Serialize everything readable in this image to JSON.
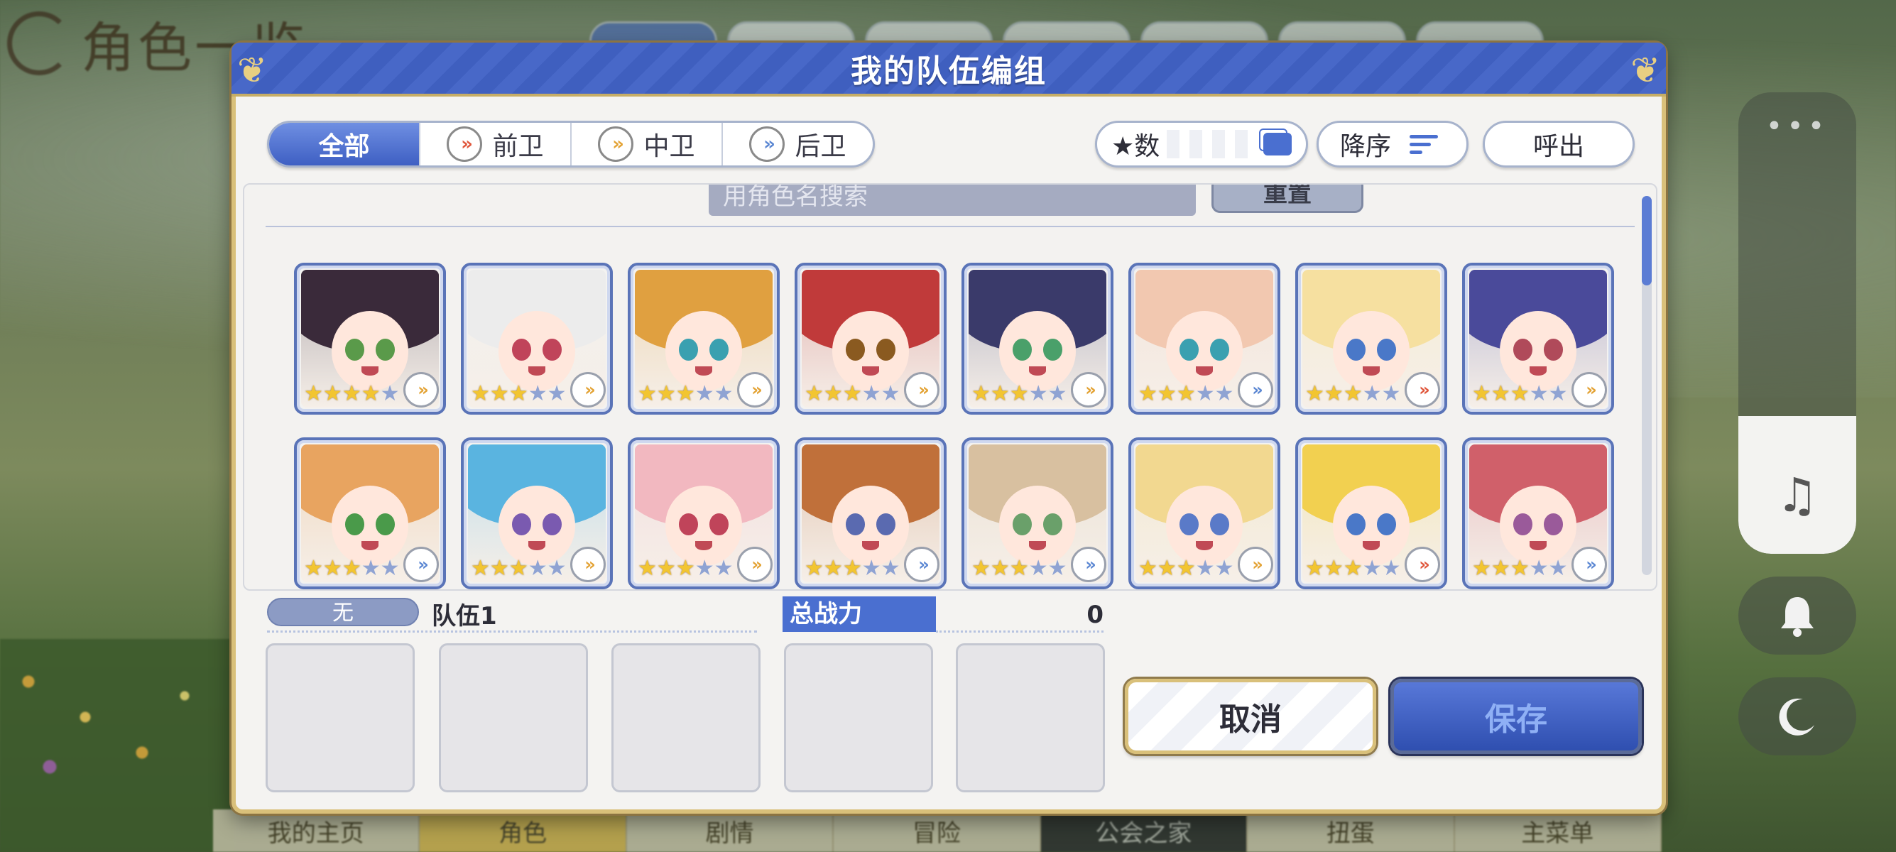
{
  "background": {
    "screen_title": "角色一览",
    "bottom_nav": [
      "我的主页",
      "角色",
      "剧情",
      "冒险",
      "公会之家",
      "扭蛋",
      "主菜单"
    ]
  },
  "dialog": {
    "title": "我的队伍编组",
    "filter_tabs": [
      {
        "label": "全部",
        "active": true,
        "icon": ""
      },
      {
        "label": "前卫",
        "active": false,
        "icon": "front-role-icon"
      },
      {
        "label": "中卫",
        "active": false,
        "icon": "mid-role-icon"
      },
      {
        "label": "后卫",
        "active": false,
        "icon": "back-role-icon"
      }
    ],
    "star_filter_label": "★数",
    "order_label": "降序",
    "call_label": "呼出",
    "search_placeholder": "用角色名搜索",
    "reset_label": "重置",
    "characters": [
      {
        "stars": 4,
        "role": "mid",
        "hair": "#3a2a3a",
        "eyes": "#5a9a4a"
      },
      {
        "stars": 3,
        "role": "mid",
        "hair": "#ececec",
        "eyes": "#c0445a"
      },
      {
        "stars": 3,
        "role": "mid",
        "hair": "#e0a040",
        "eyes": "#3aa0b0"
      },
      {
        "stars": 3,
        "role": "mid",
        "hair": "#c03a3a",
        "eyes": "#8a5a20"
      },
      {
        "stars": 3,
        "role": "mid",
        "hair": "#3a3a6a",
        "eyes": "#4aa06a"
      },
      {
        "stars": 3,
        "role": "back",
        "hair": "#f2c8b0",
        "eyes": "#3aa0b0"
      },
      {
        "stars": 3,
        "role": "front",
        "hair": "#f6e0a0",
        "eyes": "#4a78c8"
      },
      {
        "stars": 3,
        "role": "mid",
        "hair": "#4a4a9a",
        "eyes": "#b04a5a"
      },
      {
        "stars": 3,
        "role": "back",
        "hair": "#e8a460",
        "eyes": "#4a9a4a"
      },
      {
        "stars": 3,
        "role": "mid",
        "hair": "#5ab4e0",
        "eyes": "#7a5ab0"
      },
      {
        "stars": 3,
        "role": "mid",
        "hair": "#f2b8c0",
        "eyes": "#c0445a"
      },
      {
        "stars": 3,
        "role": "back",
        "hair": "#c0703a",
        "eyes": "#5a6ab0"
      },
      {
        "stars": 3,
        "role": "back",
        "hair": "#d8c0a0",
        "eyes": "#6aa06a"
      },
      {
        "stars": 3,
        "role": "mid",
        "hair": "#f2d890",
        "eyes": "#5a7ac8"
      },
      {
        "stars": 3,
        "role": "front",
        "hair": "#f2d050",
        "eyes": "#4a78c8"
      },
      {
        "stars": 3,
        "role": "back",
        "hair": "#d0606a",
        "eyes": "#9a5a9a"
      }
    ],
    "team": {
      "badge": "无",
      "name": "队伍1",
      "power_label": "总战力",
      "power_value": "0"
    },
    "cancel_label": "取消",
    "save_label": "保存"
  },
  "colors": {
    "accent": "#4a6fd0",
    "frame_gold": "#d9c07a"
  }
}
